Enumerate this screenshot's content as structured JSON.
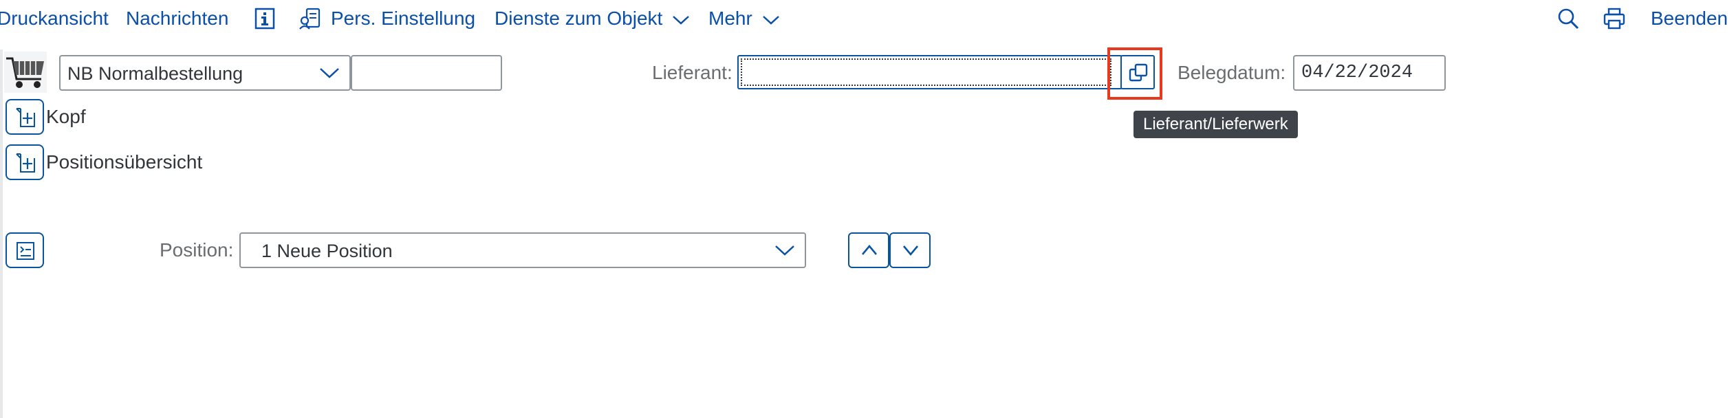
{
  "toolbar": {
    "print_preview": "Druckansicht",
    "messages": "Nachrichten",
    "info_icon": "info-icon",
    "personal_settings": "Pers. Einstellung",
    "object_services": "Dienste zum Objekt",
    "more": "Mehr",
    "exit": "Beenden"
  },
  "header": {
    "order_type": "NB Normalbestellung",
    "order_number": "",
    "vendor_label": "Lieferant:",
    "vendor_value": "",
    "vendor_tooltip": "Lieferant/Lieferwerk",
    "doc_date_label": "Belegdatum:",
    "doc_date_value": "04/22/2024"
  },
  "sections": {
    "header": "Kopf",
    "item_overview": "Positionsübersicht"
  },
  "item": {
    "position_label": "Position:",
    "position_value": "1 Neue Position"
  },
  "colors": {
    "link": "#0a4fa8",
    "border_focus": "#0854a0",
    "highlight": "#e8381e",
    "tooltip_bg": "#3e4449"
  }
}
